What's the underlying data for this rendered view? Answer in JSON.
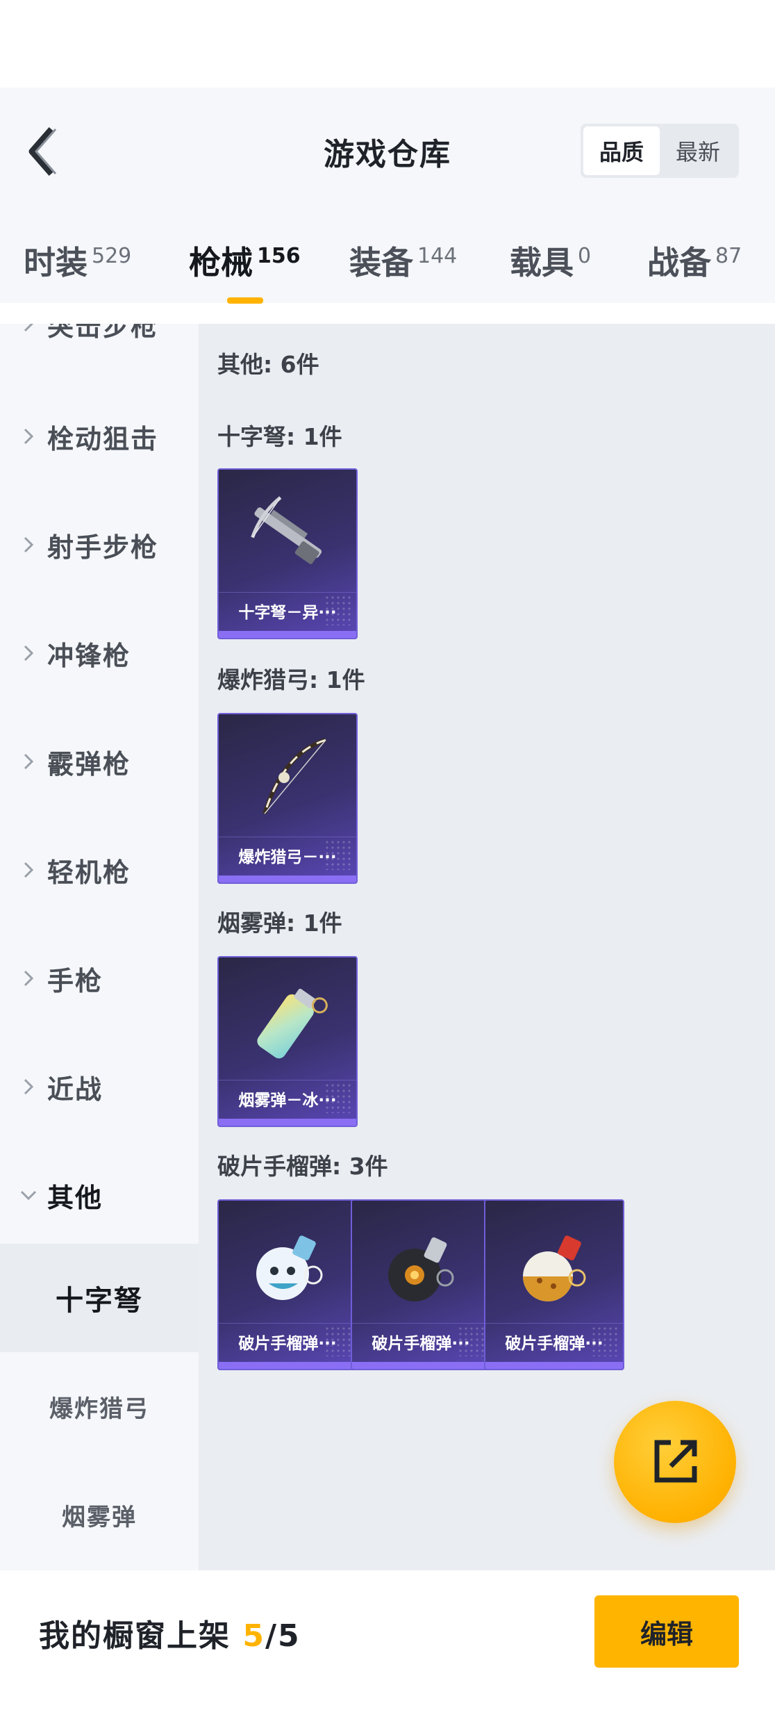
{
  "header": {
    "title": "游戏仓库",
    "sort_options": [
      "品质",
      "最新"
    ],
    "sort_selected": "品质"
  },
  "tabs": [
    {
      "label": "时装",
      "count": "529"
    },
    {
      "label": "枪械",
      "count": "156",
      "active": true
    },
    {
      "label": "装备",
      "count": "144"
    },
    {
      "label": "载具",
      "count": "0"
    },
    {
      "label": "战备",
      "count": "87"
    }
  ],
  "sidebar": {
    "partial_top": "突击步枪",
    "items": [
      "栓动狙击",
      "射手步枪",
      "冲锋枪",
      "霰弹枪",
      "轻机枪",
      "手枪",
      "近战"
    ],
    "expanded": "其他",
    "subitems": [
      "十字弩",
      "爆炸猎弓",
      "烟雾弹"
    ],
    "selected_sub": "十字弩"
  },
  "content": {
    "summary": "其他: 6件",
    "groups": [
      {
        "title": "十字弩: 1件",
        "items": [
          "十字弩－异···"
        ]
      },
      {
        "title": "爆炸猎弓: 1件",
        "items": [
          "爆炸猎弓－···"
        ]
      },
      {
        "title": "烟雾弹: 1件",
        "items": [
          "烟雾弹－冰···"
        ]
      },
      {
        "title": "破片手榴弹: 3件",
        "items": [
          "破片手榴弹···",
          "破片手榴弹···",
          "破片手榴弹···"
        ]
      }
    ]
  },
  "bottom": {
    "showcase_label": "我的橱窗上架",
    "showcase_current": "5",
    "showcase_total": "/5",
    "edit_label": "编辑"
  },
  "icons": {
    "back": "chevron-left-icon",
    "fab": "share-external-icon"
  },
  "colors": {
    "accent": "#ffb300",
    "card_gradient_end": "#5a47b6",
    "card_border": "#6f5ed8"
  }
}
